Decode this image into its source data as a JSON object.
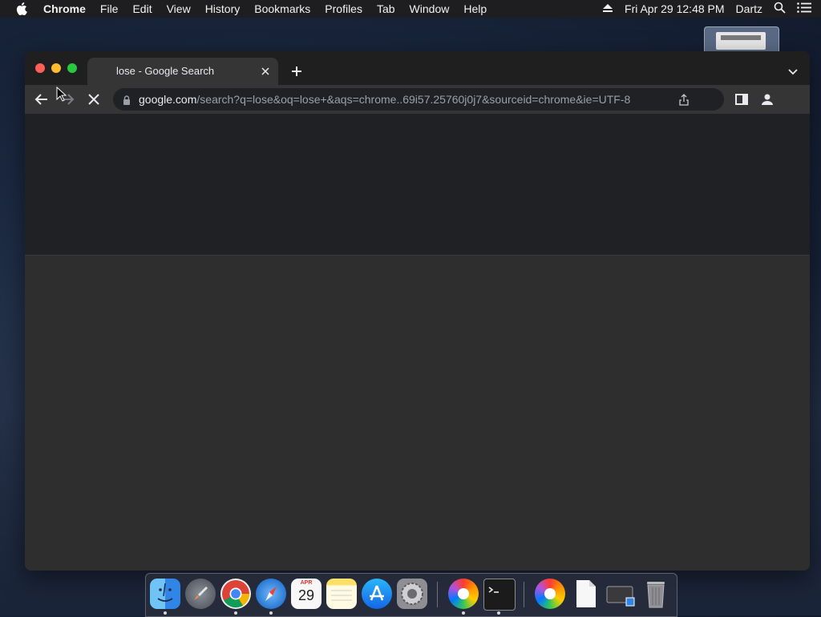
{
  "menubar": {
    "app_name": "Chrome",
    "items": [
      "File",
      "Edit",
      "View",
      "History",
      "Bookmarks",
      "Profiles",
      "Tab",
      "Window",
      "Help"
    ],
    "datetime": "Fri Apr 29  12:48 PM",
    "user": "Dartz"
  },
  "browser": {
    "tab_title": "lose - Google Search",
    "url_domain": "google.com",
    "url_path": "/search?q=lose&oq=lose+&aqs=chrome..69i57.25760j0j7&sourceid=chrome&ie=UTF-8"
  },
  "dock": {
    "calendar_month": "APR",
    "calendar_day": "29",
    "apps": [
      "finder-icon",
      "launchpad-icon",
      "chrome-icon",
      "safari-icon",
      "calendar-icon",
      "notes-icon",
      "app-store-icon",
      "system-preferences-icon",
      "color-picker-icon",
      "terminal-icon",
      "color-picker-icon",
      "document-icon",
      "screen-icon",
      "trash-icon"
    ]
  },
  "colors": {
    "traffic_close": "#ff5f57",
    "traffic_min": "#febc2e",
    "traffic_max": "#28c840",
    "omnibox_bg": "#202124"
  }
}
